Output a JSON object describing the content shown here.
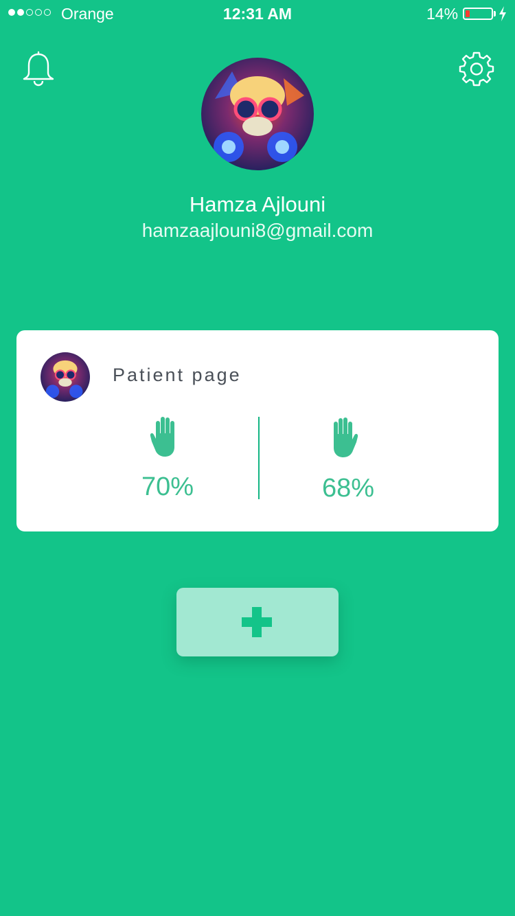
{
  "status_bar": {
    "carrier": "Orange",
    "time": "12:31 AM",
    "battery": "14%",
    "signal_bars_filled": 2,
    "signal_bars_total": 5
  },
  "header": {
    "notifications_icon": "bell-icon",
    "settings_icon": "gear-icon"
  },
  "profile": {
    "name": "Hamza Ajlouni",
    "email": "hamzaajlouni8@gmail.com"
  },
  "patient_card": {
    "title": "Patient page",
    "left_hand_icon": "hand-icon",
    "right_hand_icon": "hand-icon",
    "left_value": "70%",
    "right_value": "68%"
  },
  "actions": {
    "add_icon": "plus-icon"
  },
  "colors": {
    "background": "#13c489",
    "accent": "#3cbf91",
    "card": "#ffffff",
    "add_button": "#a2e8d2",
    "battery_low": "#ff3b30"
  }
}
